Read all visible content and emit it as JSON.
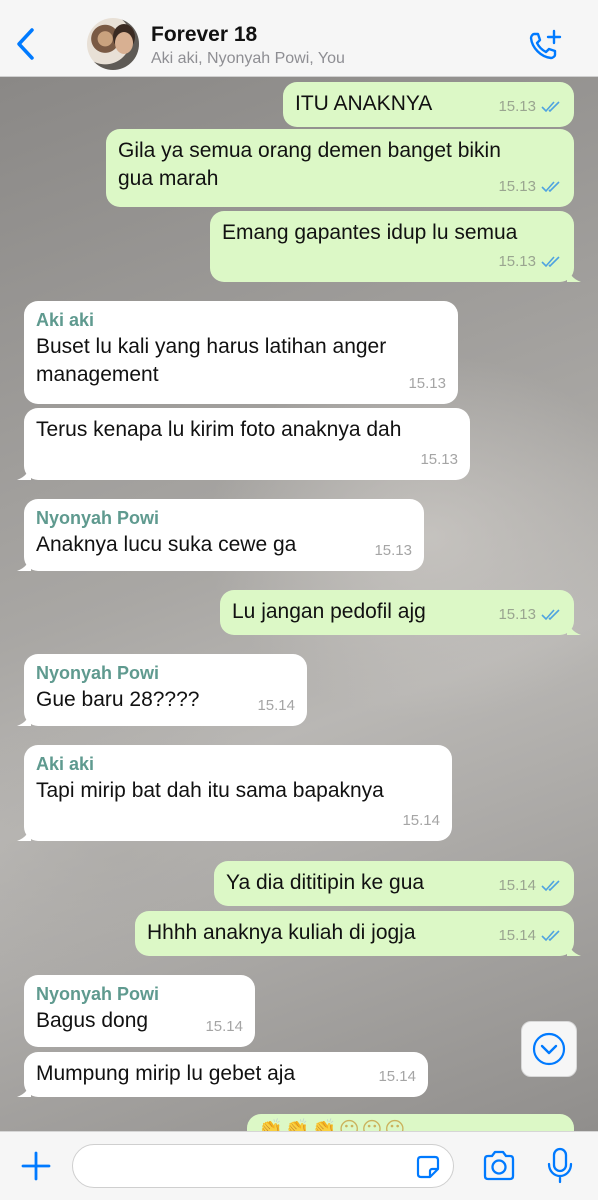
{
  "header": {
    "title": "Forever 18",
    "subtitle": "Aki aki, Nyonyah Powi, You"
  },
  "messages": [
    {
      "dir": "out",
      "text": "ITU ANAKNYA",
      "time": "15.13"
    },
    {
      "dir": "out",
      "text": "Gila ya semua orang demen banget bikin\ngua marah",
      "time": "15.13"
    },
    {
      "dir": "out",
      "text": "Emang gapantes idup lu semua",
      "time": "15.13"
    },
    {
      "dir": "in",
      "sender": "Aki aki",
      "text": "Buset lu kali yang harus latihan anger\nmanagement",
      "time": "15.13"
    },
    {
      "dir": "in",
      "text": "Terus kenapa lu kirim foto anaknya dah",
      "time": "15.13"
    },
    {
      "dir": "in",
      "sender": "Nyonyah Powi",
      "text": "Anaknya lucu suka cewe ga",
      "time": "15.13"
    },
    {
      "dir": "out",
      "text": "Lu jangan pedofil ajg",
      "time": "15.13"
    },
    {
      "dir": "in",
      "sender": "Nyonyah Powi",
      "text": "Gue baru 28????",
      "time": "15.14"
    },
    {
      "dir": "in",
      "sender": "Aki aki",
      "text": "Tapi mirip bat dah itu sama bapaknya",
      "time": "15.14"
    },
    {
      "dir": "out",
      "text": "Ya dia dititipin ke gua",
      "time": "15.14"
    },
    {
      "dir": "out",
      "text": "Hhhh anaknya kuliah di jogja",
      "time": "15.14"
    },
    {
      "dir": "in",
      "sender": "Nyonyah Powi",
      "text": "Bagus dong",
      "time": "15.14"
    },
    {
      "dir": "in",
      "text": "Mumpung mirip lu gebet aja",
      "time": "15.14"
    }
  ],
  "partial_message_emoji": "👏👏👏😶😶😶",
  "icons": {
    "back": "chevron-left-icon",
    "call": "phone-plus-icon",
    "scroll": "chevron-down-circle-icon",
    "add": "plus-icon",
    "sticker": "sticker-icon",
    "camera": "camera-icon",
    "mic": "microphone-icon"
  },
  "colors": {
    "accent": "#007aff",
    "outgoing_bubble": "#dcf8c6",
    "incoming_bubble": "#ffffff",
    "sender_name": "#5f9a8f",
    "read_ticks": "#4fa3e0"
  }
}
